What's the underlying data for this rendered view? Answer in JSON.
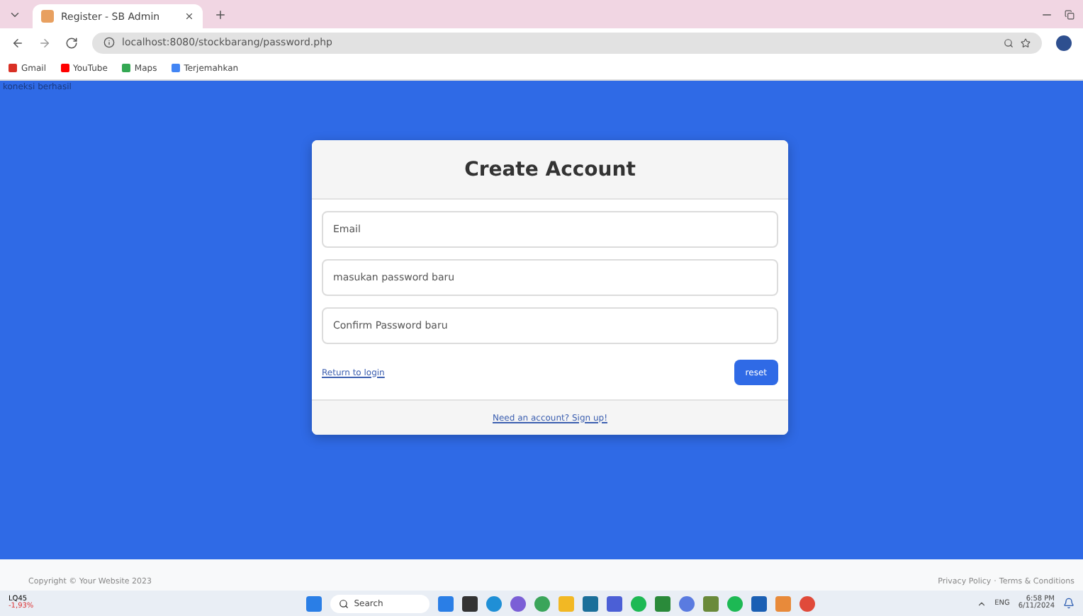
{
  "browser": {
    "tabs": [
      {
        "title": "Register - SB Admin",
        "selected": true
      }
    ],
    "url": "localhost:8080/stockbarang/password.php",
    "bookmarks": [
      {
        "label": "Gmail",
        "color": "#d93025"
      },
      {
        "label": "YouTube",
        "color": "#ff0000"
      },
      {
        "label": "Maps",
        "color": "#34a853"
      },
      {
        "label": "Terjemahkan",
        "color": "#4285f4"
      }
    ]
  },
  "page": {
    "status_text": "koneksi berhasil",
    "card": {
      "title": "Create Account",
      "fields": [
        {
          "placeholder": "Email"
        },
        {
          "placeholder": "masukan password baru"
        },
        {
          "placeholder": "Confirm Password baru"
        }
      ],
      "return_link": "Return to login",
      "submit_button": "reset",
      "footer_link": "Need an account? Sign up!"
    },
    "footer": {
      "copyright": "Copyright © Your Website 2023",
      "links": [
        "Privacy Policy",
        "Terms & Conditions"
      ],
      "separator": "·"
    }
  },
  "taskbar": {
    "stock": {
      "name": "LQ45",
      "change": "-1,93%"
    },
    "search": "Search",
    "language": "ENG",
    "time": "6:58 PM",
    "date": "6/11/2024"
  }
}
